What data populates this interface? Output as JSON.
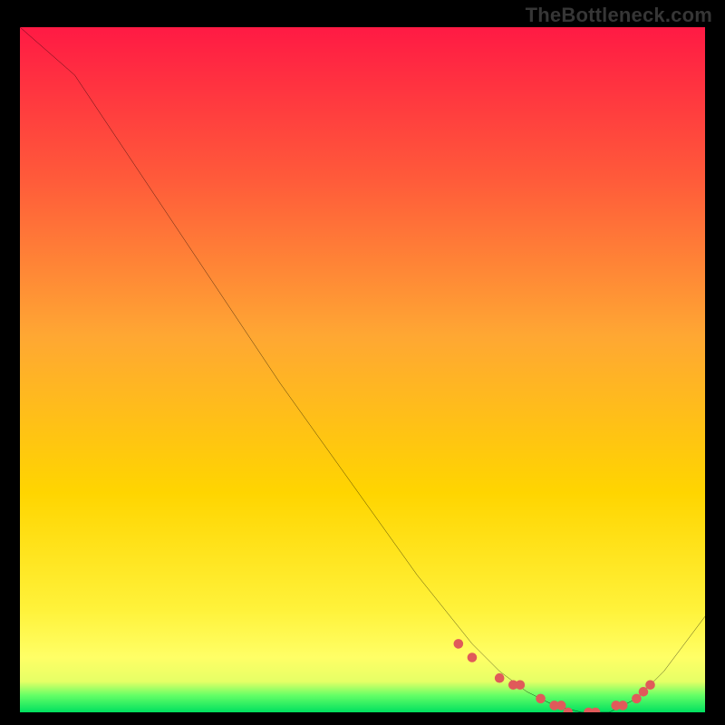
{
  "attribution": "TheBottleneck.com",
  "chart_data": {
    "type": "line",
    "title": "",
    "xlabel": "",
    "ylabel": "",
    "xlim": [
      0,
      100
    ],
    "ylim": [
      0,
      100
    ],
    "background_gradient": {
      "top": "#ff1a44",
      "mid": "#ffd500",
      "premin": "#ffff66",
      "min": "#00e060"
    },
    "series": [
      {
        "name": "bottleneck-curve",
        "x": [
          0,
          8,
          18,
          28,
          38,
          48,
          58,
          66,
          70,
          74,
          78,
          82,
          86,
          90,
          94,
          100
        ],
        "y": [
          100,
          93,
          78,
          63,
          48,
          34,
          20,
          10,
          6,
          3,
          1,
          0,
          0,
          2,
          6,
          14
        ]
      }
    ],
    "markers": {
      "name": "minimum-region-dots",
      "x": [
        64,
        66,
        70,
        72,
        73,
        76,
        78,
        79,
        80,
        83,
        84,
        87,
        88,
        90,
        91,
        92
      ],
      "y": [
        10,
        8,
        5,
        4,
        4,
        2,
        1,
        1,
        0,
        0,
        0,
        1,
        1,
        2,
        3,
        4
      ]
    }
  }
}
